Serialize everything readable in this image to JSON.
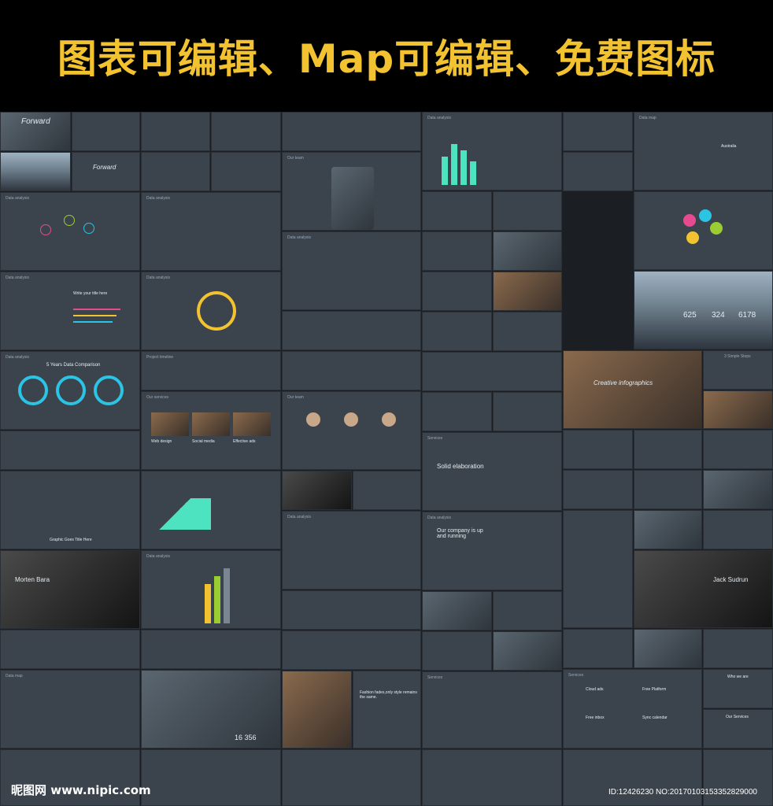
{
  "banner": {
    "title": "图表可编辑、Map可编辑、免费图标"
  },
  "slides": {
    "forward": "Forward",
    "data_analysis": "Data analysis",
    "our_team": "Our team",
    "data_map": "Data map",
    "five_years": "5 Years Data Comparison",
    "project_timeline": "Project timeline",
    "our_services": "Our services",
    "web_design": "Web design",
    "social_media": "Social media",
    "effective_ads": "Effective ads",
    "services": "Services",
    "solid_elaboration": "Solid elaboration",
    "morten": "Morten Bara",
    "company_running": "Our company is up and running",
    "jack": "Jack Sudrun",
    "creative": "Creative infographics",
    "three_steps": "3 Simple Steps",
    "graphic_title": "Graphic Goes Title Here",
    "cloud_ads": "Cloud ads",
    "free_platform": "Free Platform",
    "free_inbox": "Free inbox",
    "sync_calendar": "Sync calendar",
    "who_we_are": "Who we are",
    "our_services_small": "Our Services",
    "fashion": "Fashion fades,only style remains the same.",
    "australia": "Australia",
    "stat_a": "625",
    "stat_b": "324",
    "stat_c": "6178",
    "big_num": "16 356",
    "write_title": "Write your title here"
  },
  "watermark": {
    "logo": "昵图网 www.nipic.com",
    "id": "ID:12426230 NO:20170103153352829000"
  }
}
